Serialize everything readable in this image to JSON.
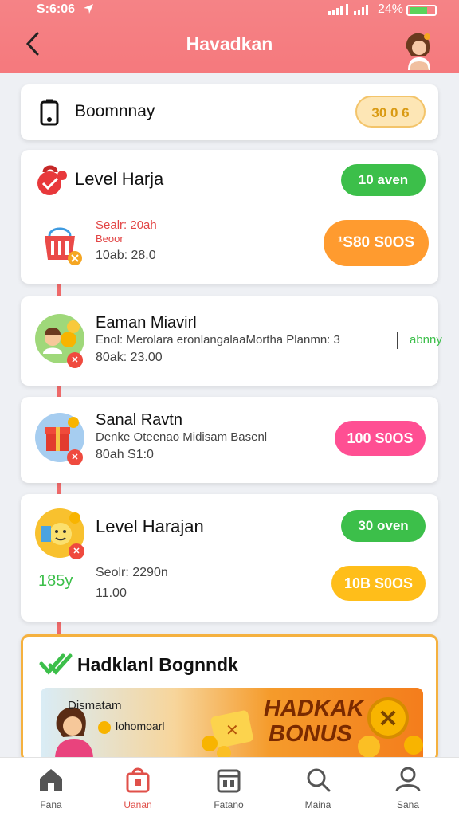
{
  "status_bar": {
    "time": "S:6:06",
    "battery": "24%"
  },
  "header": {
    "title": "Havadkan"
  },
  "balance_card": {
    "label": "Boomnnay",
    "amount": "30 0 6"
  },
  "level_card_1": {
    "title": "Level Harja",
    "badge": "10 aven",
    "line1": "Sealr: 20ah",
    "line2": "Beoor",
    "line3": "10ab: 28.0",
    "button": "¹S80 S0OS"
  },
  "task_1": {
    "title": "Eaman Miavirl",
    "desc": "Enol: Merolara eronlangalaaMortha Planmn: 3",
    "tag": "abnny",
    "sub": "80ak: 23.00"
  },
  "task_2": {
    "title": "Sanal Ravtn",
    "desc": "Denke Oteenao Midisam Basenl",
    "sub": "80ah S1:0",
    "button": "100 S0OS"
  },
  "level_card_2": {
    "title": "Level Harajan",
    "badge": "30 oven",
    "side": "185y",
    "line1": "Seolr: 2290n",
    "line2": "11.00",
    "button": "10B S0OS"
  },
  "bonus_card": {
    "title": "Hadklanl Bognndk",
    "banner_small_1": "Dismatam",
    "banner_small_2": "lohomoarl",
    "banner_big_1": "HADKAK",
    "banner_big_2": "BONUS"
  },
  "nav": [
    {
      "label": "Fana",
      "icon": "home-icon"
    },
    {
      "label": "Uanan",
      "icon": "gift-icon"
    },
    {
      "label": "Fatano",
      "icon": "calendar-icon"
    },
    {
      "label": "Maina",
      "icon": "search-icon"
    },
    {
      "label": "Sana",
      "icon": "profile-icon"
    }
  ],
  "colors": {
    "header": "#f5797d",
    "green": "#3cbf4a",
    "orange": "#ff9b2f",
    "pink": "#ff4f93",
    "yellow": "#ffbe1a",
    "accent_red": "#e0504a"
  }
}
